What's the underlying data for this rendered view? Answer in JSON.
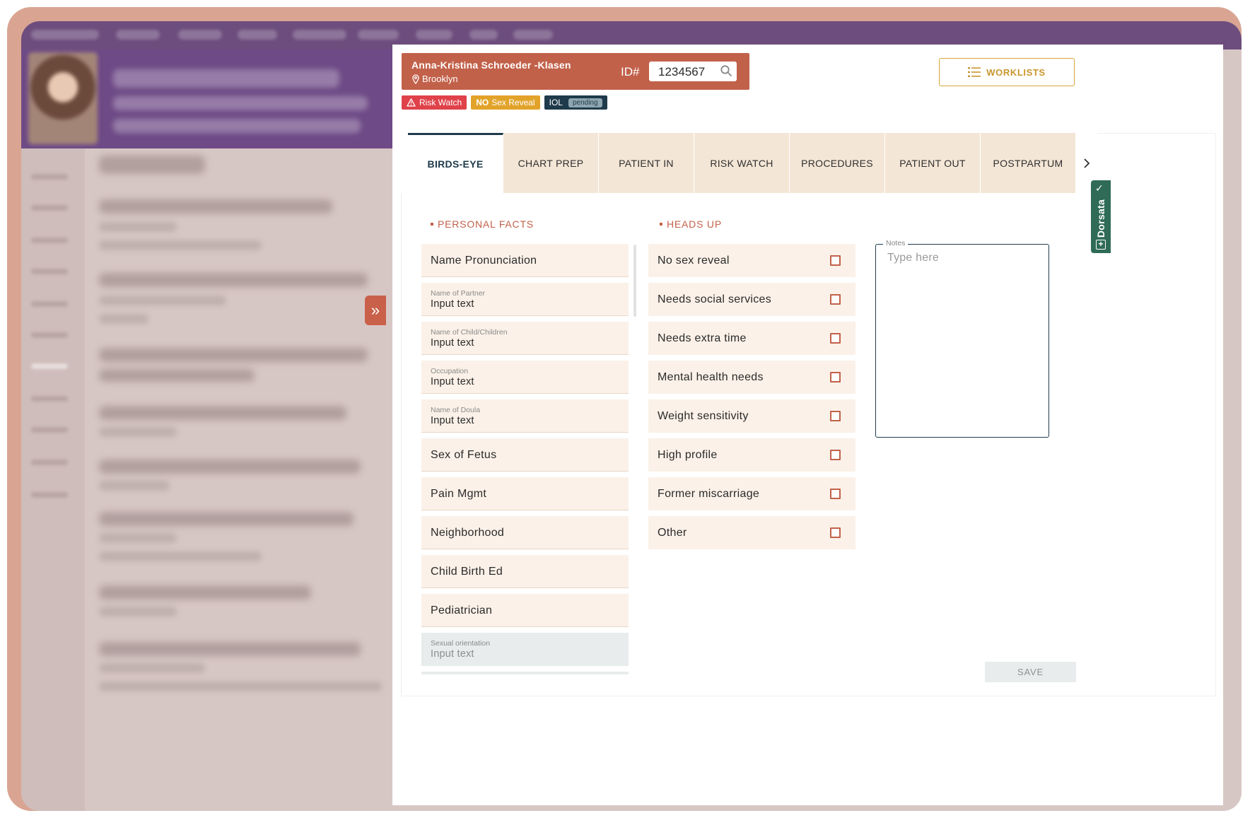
{
  "patient": {
    "name": "Anna-Kristina Schroeder -Klasen",
    "location": "Brooklyn",
    "id_label": "ID#",
    "id_value": "1234567"
  },
  "badges": {
    "risk_watch": "Risk Watch",
    "no_prefix": "NO",
    "sex_reveal": "Sex Reveal",
    "iol": "IOL",
    "iol_status": "pending"
  },
  "worklists_label": "WORKLISTS",
  "tabs": [
    "BIRDS-EYE",
    "CHART PREP",
    "PATIENT IN",
    "RISK WATCH",
    "PROCEDURES",
    "PATIENT OUT",
    "POSTPARTUM"
  ],
  "sections": {
    "personal_facts": "PERSONAL FACTS",
    "heads_up": "HEADS UP"
  },
  "personal_facts": [
    {
      "label": "Name Pronunciation"
    },
    {
      "label": "Name of Partner",
      "value": "Input text"
    },
    {
      "label": "Name of Child/Children",
      "value": "Input text"
    },
    {
      "label": "Occupation",
      "value": "Input text"
    },
    {
      "label": "Name of Doula",
      "value": "Input text"
    },
    {
      "label": "Sex of Fetus"
    },
    {
      "label": "Pain Mgmt"
    },
    {
      "label": "Neighborhood"
    },
    {
      "label": "Child Birth Ed"
    },
    {
      "label": "Pediatrician"
    },
    {
      "label": "Sexual orientation",
      "value": "Input text"
    }
  ],
  "heads_up": [
    "No sex reveal",
    "Needs social services",
    "Needs extra time",
    "Mental health needs",
    "Weight sensitivity",
    "High profile",
    "Former miscarriage",
    "Other"
  ],
  "notes": {
    "label": "Notes",
    "placeholder": "Type here"
  },
  "save_label": "SAVE",
  "dorsata_label": "Dorsata",
  "colors": {
    "accent": "#c2614a",
    "navy": "#1f3b4b",
    "tab_bg": "#f4e6d6",
    "field_bg": "#fbf1e8",
    "worklists": "#d6a53b",
    "risk": "#e0424a",
    "sex_reveal": "#e2a32a",
    "dorsata": "#2f6b57"
  }
}
